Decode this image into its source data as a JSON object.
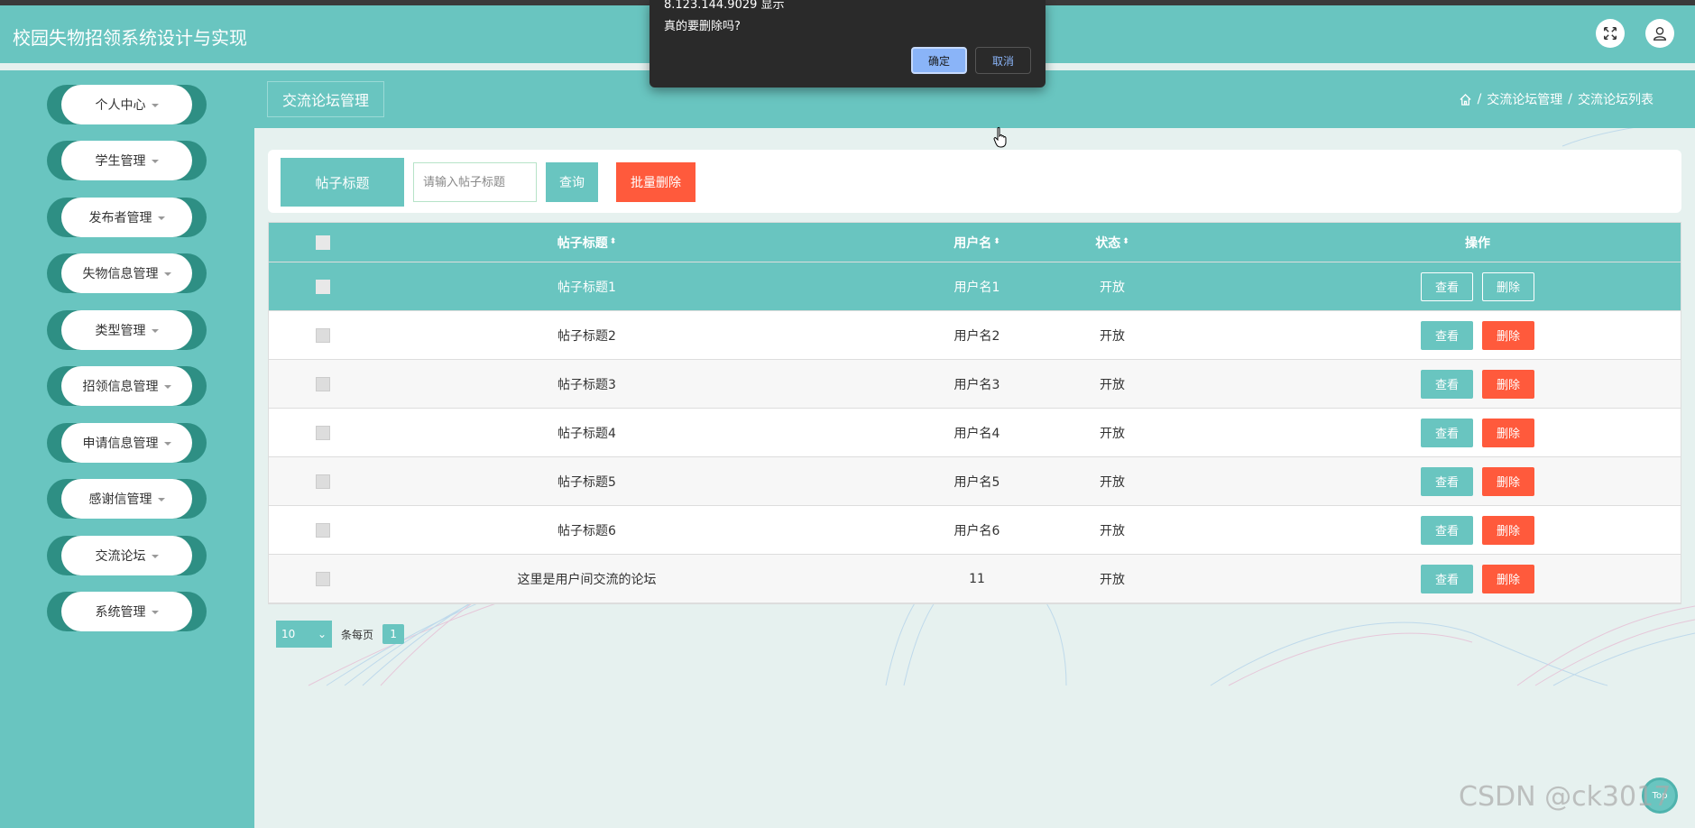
{
  "app": {
    "title": "校园失物招领系统设计与实现"
  },
  "header": {
    "fullscreen_icon": "fullscreen-icon",
    "user_icon": "user-icon"
  },
  "sidebar": {
    "items": [
      {
        "label": "个人中心"
      },
      {
        "label": "学生管理"
      },
      {
        "label": "发布者管理"
      },
      {
        "label": "失物信息管理"
      },
      {
        "label": "类型管理"
      },
      {
        "label": "招领信息管理"
      },
      {
        "label": "申请信息管理"
      },
      {
        "label": "感谢信管理"
      },
      {
        "label": "交流论坛"
      },
      {
        "label": "系统管理"
      }
    ]
  },
  "page": {
    "title": "交流论坛管理",
    "breadcrumb": [
      "交流论坛管理",
      "交流论坛列表"
    ],
    "breadcrumb_sep": "/"
  },
  "search": {
    "label": "帖子标题",
    "placeholder": "请输入帖子标题",
    "query_label": "查询",
    "batch_delete_label": "批量删除"
  },
  "table": {
    "columns": [
      "帖子标题",
      "用户名",
      "状态",
      "操作"
    ],
    "sort_glyph": "⬍",
    "rows": [
      {
        "title": "帖子标题1",
        "user": "用户名1",
        "status": "开放"
      },
      {
        "title": "帖子标题2",
        "user": "用户名2",
        "status": "开放"
      },
      {
        "title": "帖子标题3",
        "user": "用户名3",
        "status": "开放"
      },
      {
        "title": "帖子标题4",
        "user": "用户名4",
        "status": "开放"
      },
      {
        "title": "帖子标题5",
        "user": "用户名5",
        "status": "开放"
      },
      {
        "title": "帖子标题6",
        "user": "用户名6",
        "status": "开放"
      },
      {
        "title": "这里是用户间交流的论坛",
        "user": "11",
        "status": "开放"
      }
    ],
    "view_label": "查看",
    "delete_label": "删除"
  },
  "pagination": {
    "page_size": "10",
    "per_page_label": "条每页",
    "current_page": "1"
  },
  "dialog": {
    "origin": "8.123.144.9029 显示",
    "message": "真的要删除吗?",
    "ok_label": "确定",
    "cancel_label": "取消"
  },
  "float_button": {
    "label": "Top"
  },
  "watermark": "CSDN @ck3017",
  "colors": {
    "primary": "#69c5c0",
    "sidebar_dark": "#2e8f84",
    "danger": "#ff5a3c",
    "dialog_bg": "#2a2a2a"
  }
}
